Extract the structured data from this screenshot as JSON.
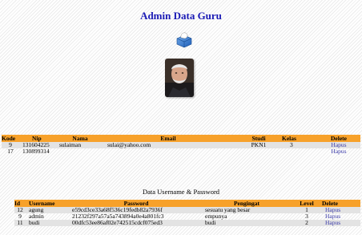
{
  "header": {
    "title": "Admin Data Guru"
  },
  "icons": {
    "logo": "tissue-box-icon",
    "avatar": "avatar-photo"
  },
  "colors": {
    "header_bg": "#f7a12a",
    "title": "#1a1ab5",
    "link": "#3a3aa8",
    "row_alt": "#e3e3e3"
  },
  "guru_table": {
    "headers": {
      "kode": "Kode",
      "nip": "Nip",
      "nama": "Nama",
      "email": "Email",
      "studi": "Studi",
      "kelas": "Kelas",
      "delete": "Delete"
    },
    "rows": [
      {
        "kode": "9",
        "nip": "131604225",
        "nama": "sulaiman",
        "email": "sulai@yahoo.com",
        "studi": "PKN1",
        "kelas": "3",
        "delete": "Hapus"
      },
      {
        "kode": "17",
        "nip": "130899314",
        "nama": "",
        "email": "",
        "studi": "",
        "kelas": "",
        "delete": "Hapus"
      }
    ]
  },
  "user_section": {
    "title": "Data Username & Password"
  },
  "user_table": {
    "headers": {
      "id": "Id",
      "username": "Username",
      "password": "Password",
      "pengingat": "Pengingat",
      "level": "Level",
      "delete": "Delete"
    },
    "rows": [
      {
        "id": "12",
        "username": "agung",
        "password": "e59cd3ce33a68f536c19fedb82a7936f",
        "pengingat": "sesuatu yang besar",
        "level": "1",
        "delete": "Hapus"
      },
      {
        "id": "9",
        "username": "admin",
        "password": "21232f297a57a5a743894a0e4a801fc3",
        "pengingat": "empunya",
        "level": "3",
        "delete": "Hapus"
      },
      {
        "id": "11",
        "username": "budi",
        "password": "00dfc53ee86af02e742515cdcf075ed3",
        "pengingat": "budi",
        "level": "2",
        "delete": "Hapus"
      }
    ]
  }
}
